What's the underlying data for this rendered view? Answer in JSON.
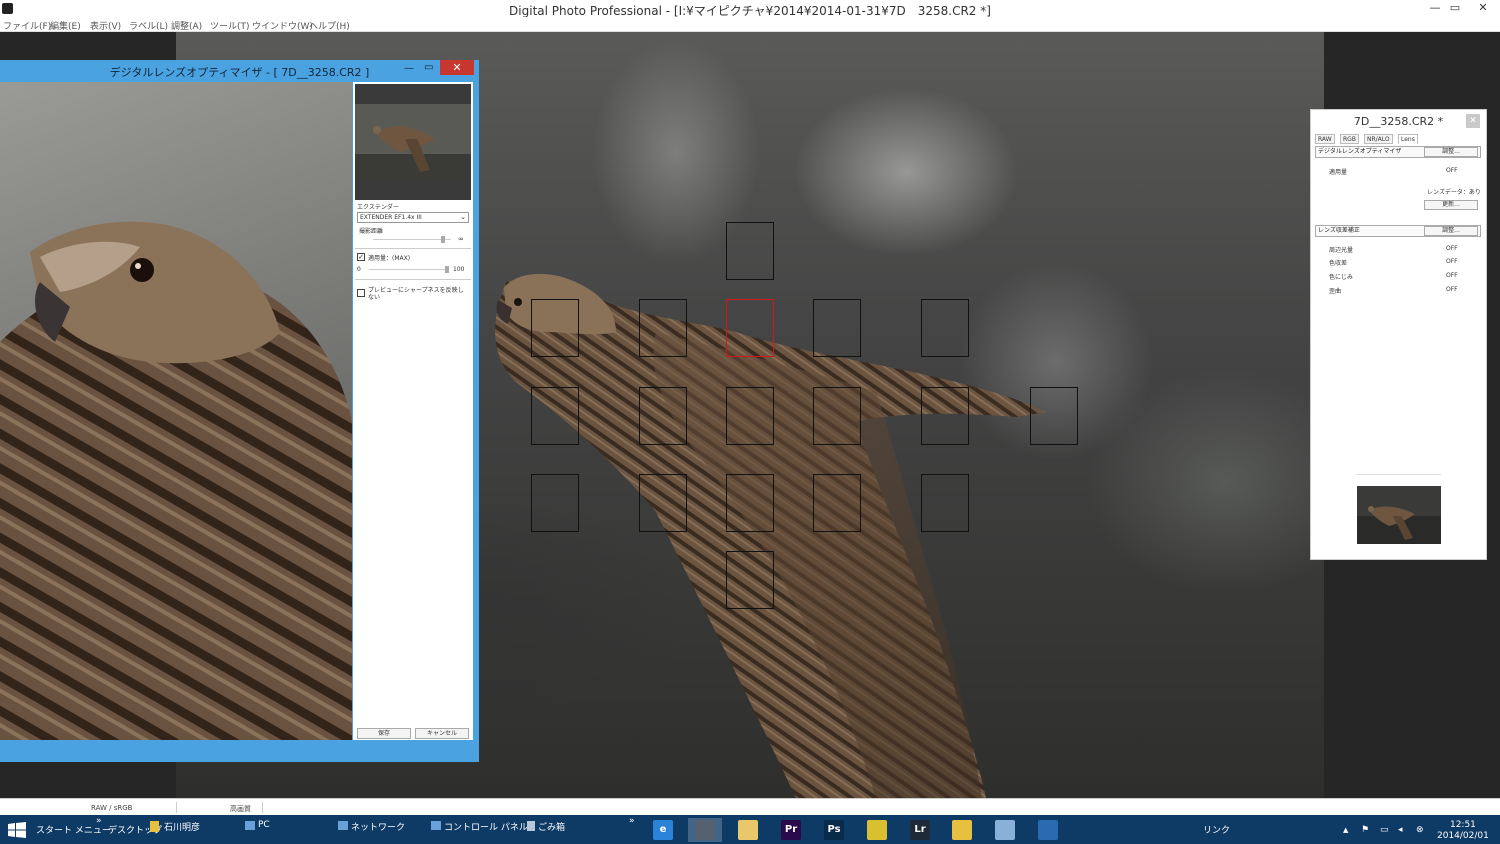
{
  "window": {
    "title": "Digital Photo Professional - [I:¥マイピクチャ¥2014¥2014-01-31¥7D__3258.CR2 *]",
    "controls": [
      "—",
      "▭",
      "✕"
    ]
  },
  "menu": [
    "ファイル(F)",
    "編集(E)",
    "表示(V)",
    "ラベル(L)",
    "調整(A)",
    "ツール(T)",
    "ウインドウ(W)",
    "ヘルプ(H)"
  ],
  "dlo_dialog": {
    "title": "デジタルレンズオプティマイザ - [ 7D__3258.CR2 ]",
    "close": "✕",
    "minimize": "—",
    "maximize": "▭",
    "extender_label": "エクステンダー",
    "extender_value": "EXTENDER EF1.4x III",
    "distance_label": "撮影距離",
    "distance_max": "∞",
    "apply_label": "適用量：(MAX)",
    "apply_checked": true,
    "slider_min": "0",
    "slider_max": "100",
    "sharpness_label": "プレビューにシャープネスを反映しない",
    "save_button": "保存",
    "cancel_button": "キャンセル"
  },
  "palette": {
    "title": "7D__3258.CR2 *",
    "close": "✕",
    "tabs": [
      "RAW",
      "RGB",
      "NR/ALO",
      "Lens"
    ],
    "selected_tab": "Lens",
    "dlo_header": "デジタルレンズオプティマイザ",
    "adjust_button": "調整...",
    "apply_label": "適用量",
    "apply_value": "OFF",
    "lens_data_label": "レンズデータ：あり",
    "update_button": "更新...",
    "aberration_header": "レンズ収差補正",
    "aberration_adjust_button": "調整...",
    "rows": [
      {
        "label": "周辺光量",
        "value": "OFF"
      },
      {
        "label": "色収差",
        "value": "OFF"
      },
      {
        "label": "色にじみ",
        "value": "OFF"
      },
      {
        "label": "歪曲",
        "value": "OFF"
      }
    ]
  },
  "status": {
    "profile": "RAW / sRGB",
    "quality": "高画質"
  },
  "taskbar": {
    "start_menu": "スタート メニュー",
    "desktop": "デスクトップ",
    "user": "石川明彦",
    "pc": "PC",
    "network": "ネットワーク",
    "control_panel": "コントロール パネル",
    "recycle": "ごみ箱",
    "links": "リンク",
    "time": "12:51",
    "date": "2014/02/01",
    "apps": [
      {
        "name": "ie-icon",
        "glyph": "e",
        "color": "#2a83d6"
      },
      {
        "name": "dpp-icon",
        "glyph": "",
        "color": "#556070"
      },
      {
        "name": "explorer-icon",
        "glyph": "",
        "color": "#e8c86a"
      },
      {
        "name": "premiere-icon",
        "glyph": "Pr",
        "color": "#2a0a4a"
      },
      {
        "name": "photoshop-icon",
        "glyph": "Ps",
        "color": "#0a2a4a"
      },
      {
        "name": "chrome-icon",
        "glyph": "",
        "color": "#d8c030"
      },
      {
        "name": "lightroom-icon",
        "glyph": "Lr",
        "color": "#1e2a38"
      },
      {
        "name": "folder-icon",
        "glyph": "",
        "color": "#e8c040"
      },
      {
        "name": "paint-icon",
        "glyph": "",
        "color": "#88b0d8"
      },
      {
        "name": "chat-icon",
        "glyph": "",
        "color": "#2a6ab0"
      }
    ]
  }
}
